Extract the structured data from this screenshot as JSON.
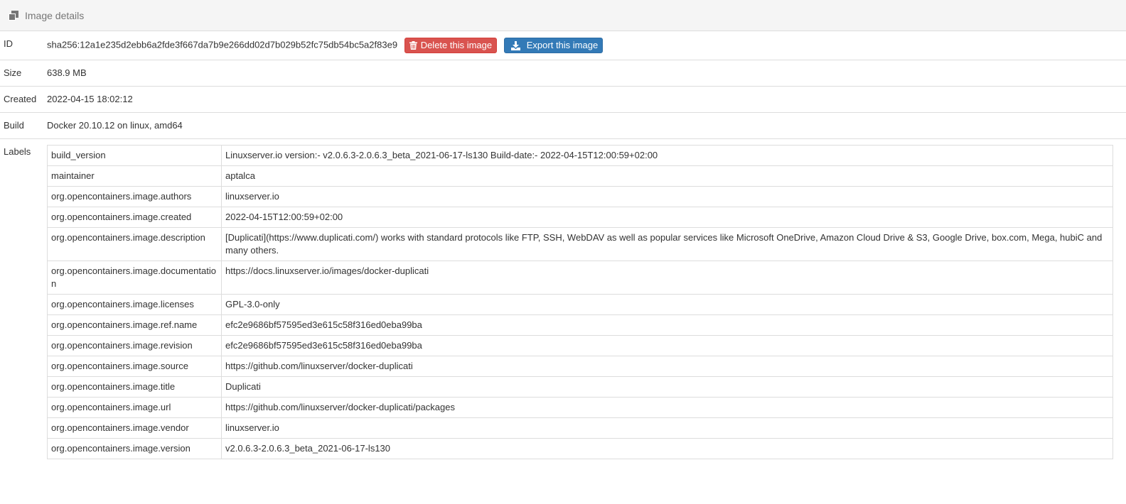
{
  "header": {
    "title": "Image details",
    "icon": "clone-icon"
  },
  "details": {
    "id": {
      "label": "ID",
      "value": "sha256:12a1e235d2ebb6a2fde3f667da7b9e266dd02d7b029b52fc75db54bc5a2f83e9"
    },
    "delete_button": "Delete this image",
    "export_button": "Export this image",
    "size": {
      "label": "Size",
      "value": "638.9 MB"
    },
    "created": {
      "label": "Created",
      "value": "2022-04-15 18:02:12"
    },
    "build": {
      "label": "Build",
      "value": "Docker 20.10.12 on linux, amd64"
    },
    "labels_label": "Labels"
  },
  "labels": [
    {
      "key": "build_version",
      "value": "Linuxserver.io version:- v2.0.6.3-2.0.6.3_beta_2021-06-17-ls130 Build-date:- 2022-04-15T12:00:59+02:00"
    },
    {
      "key": "maintainer",
      "value": "aptalca"
    },
    {
      "key": "org.opencontainers.image.authors",
      "value": "linuxserver.io"
    },
    {
      "key": "org.opencontainers.image.created",
      "value": "2022-04-15T12:00:59+02:00"
    },
    {
      "key": "org.opencontainers.image.description",
      "value": "[Duplicati](https://www.duplicati.com/) works with standard protocols like FTP, SSH, WebDAV as well as popular services like Microsoft OneDrive, Amazon Cloud Drive & S3, Google Drive, box.com, Mega, hubiC and many others."
    },
    {
      "key": "org.opencontainers.image.documentation",
      "value": "https://docs.linuxserver.io/images/docker-duplicati"
    },
    {
      "key": "org.opencontainers.image.licenses",
      "value": "GPL-3.0-only"
    },
    {
      "key": "org.opencontainers.image.ref.name",
      "value": "efc2e9686bf57595ed3e615c58f316ed0eba99ba"
    },
    {
      "key": "org.opencontainers.image.revision",
      "value": "efc2e9686bf57595ed3e615c58f316ed0eba99ba"
    },
    {
      "key": "org.opencontainers.image.source",
      "value": "https://github.com/linuxserver/docker-duplicati"
    },
    {
      "key": "org.opencontainers.image.title",
      "value": "Duplicati"
    },
    {
      "key": "org.opencontainers.image.url",
      "value": "https://github.com/linuxserver/docker-duplicati/packages"
    },
    {
      "key": "org.opencontainers.image.vendor",
      "value": "linuxserver.io"
    },
    {
      "key": "org.opencontainers.image.version",
      "value": "v2.0.6.3-2.0.6.3_beta_2021-06-17-ls130"
    }
  ]
}
